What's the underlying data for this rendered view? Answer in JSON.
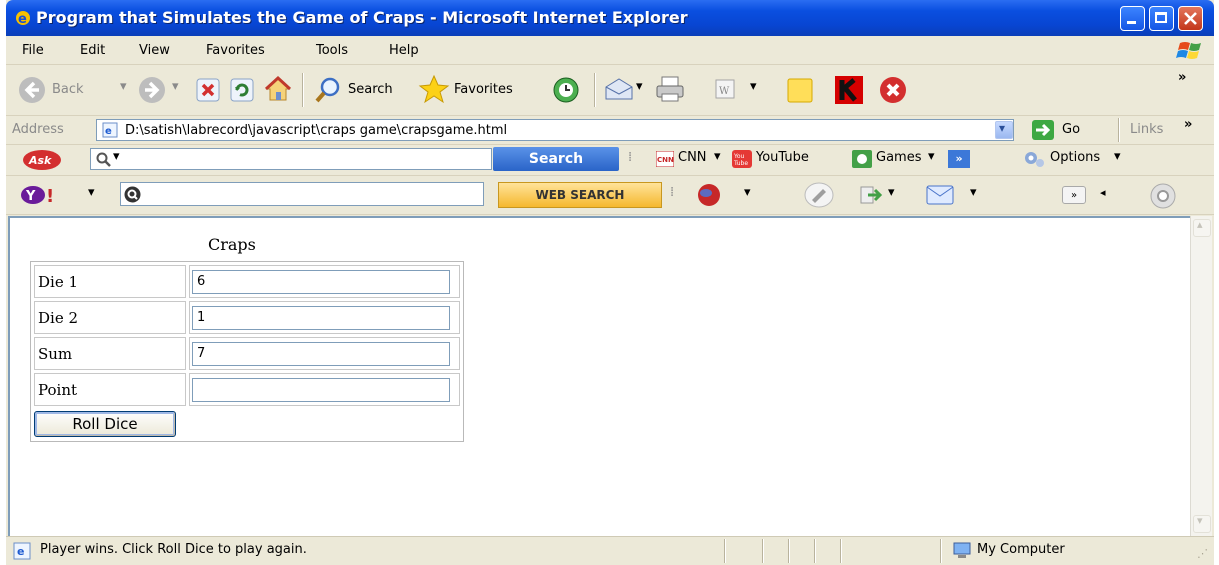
{
  "window": {
    "title": "Program that Simulates the Game of Craps - Microsoft Internet Explorer"
  },
  "menu": [
    "File",
    "Edit",
    "View",
    "Favorites",
    "Tools",
    "Help"
  ],
  "toolbar": {
    "back_label": "Back",
    "search_label": "Search",
    "favorites_label": "Favorites"
  },
  "address_bar": {
    "label": "Address",
    "url": "D:\\satish\\labrecord\\javascript\\craps game\\crapsgame.html",
    "go_label": "Go",
    "links_label": "Links",
    "chevron": "»"
  },
  "ask_toolbar": {
    "search_button": "Search",
    "cnn_label": "CNN",
    "youtube_label": "YouTube",
    "games_label": "Games",
    "options_label": "Options"
  },
  "yahoo_toolbar": {
    "web_search_button": "WEB SEARCH"
  },
  "page": {
    "heading": "Craps",
    "rows": [
      {
        "label": "Die 1",
        "value": "6"
      },
      {
        "label": "Die 2",
        "value": "1"
      },
      {
        "label": "Sum",
        "value": "7"
      },
      {
        "label": "Point",
        "value": ""
      }
    ],
    "roll_button": "Roll Dice"
  },
  "status_bar": {
    "message": "Player wins. Click Roll Dice to play again.",
    "zone": "My Computer"
  }
}
